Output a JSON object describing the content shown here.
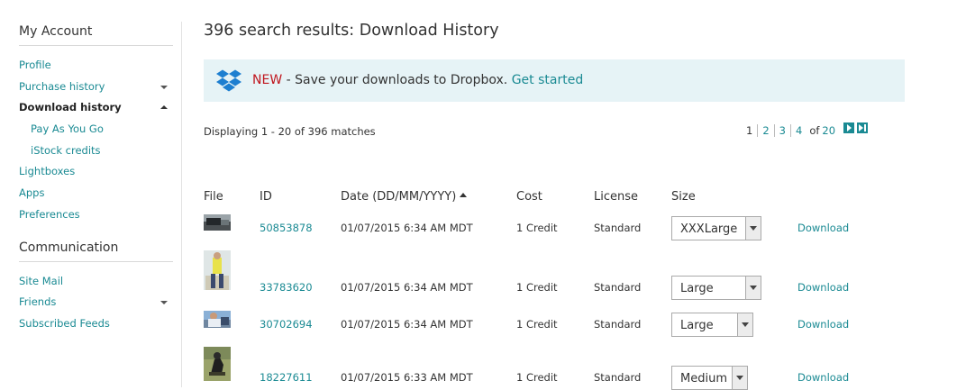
{
  "sidebar": {
    "account_heading": "My Account",
    "account_items": [
      {
        "label": "Profile"
      },
      {
        "label": "Purchase history"
      },
      {
        "label": "Download history"
      },
      {
        "label": "Pay As You Go"
      },
      {
        "label": "iStock credits"
      },
      {
        "label": "Lightboxes"
      },
      {
        "label": "Apps"
      },
      {
        "label": "Preferences"
      }
    ],
    "communication_heading": "Communication",
    "communication_items": [
      {
        "label": "Site Mail"
      },
      {
        "label": "Friends"
      },
      {
        "label": "Subscribed Feeds"
      }
    ]
  },
  "page_title": "396 search results: Download History",
  "banner": {
    "new_label": "NEW",
    "message": " - Save your downloads to Dropbox. ",
    "link": "Get started",
    "icon": "dropbox-icon",
    "accent": "#1a8a93"
  },
  "results": {
    "displaying": "Displaying 1 - 20 of 396 matches"
  },
  "pagination": {
    "pages": [
      "1",
      "2",
      "3",
      "4"
    ],
    "of_label": "of",
    "total": "20"
  },
  "table": {
    "headers": {
      "file": "File",
      "id": "ID",
      "date": "Date (DD/MM/YYYY)",
      "cost": "Cost",
      "license": "License",
      "size": "Size"
    },
    "rows": [
      {
        "id": "50853878",
        "date": "01/07/2015 6:34 AM MDT",
        "cost": "1 Credit",
        "license": "Standard",
        "size": "XXXLarge",
        "download": "Download"
      },
      {
        "id": "33783620",
        "date": "01/07/2015 6:34 AM MDT",
        "cost": "1 Credit",
        "license": "Standard",
        "size": "Large",
        "download": "Download"
      },
      {
        "id": "30702694",
        "date": "01/07/2015 6:34 AM MDT",
        "cost": "1 Credit",
        "license": "Standard",
        "size": "Large",
        "download": "Download"
      },
      {
        "id": "18227611",
        "date": "01/07/2015 6:33 AM MDT",
        "cost": "1 Credit",
        "license": "Standard",
        "size": "Medium",
        "download": "Download"
      }
    ]
  }
}
